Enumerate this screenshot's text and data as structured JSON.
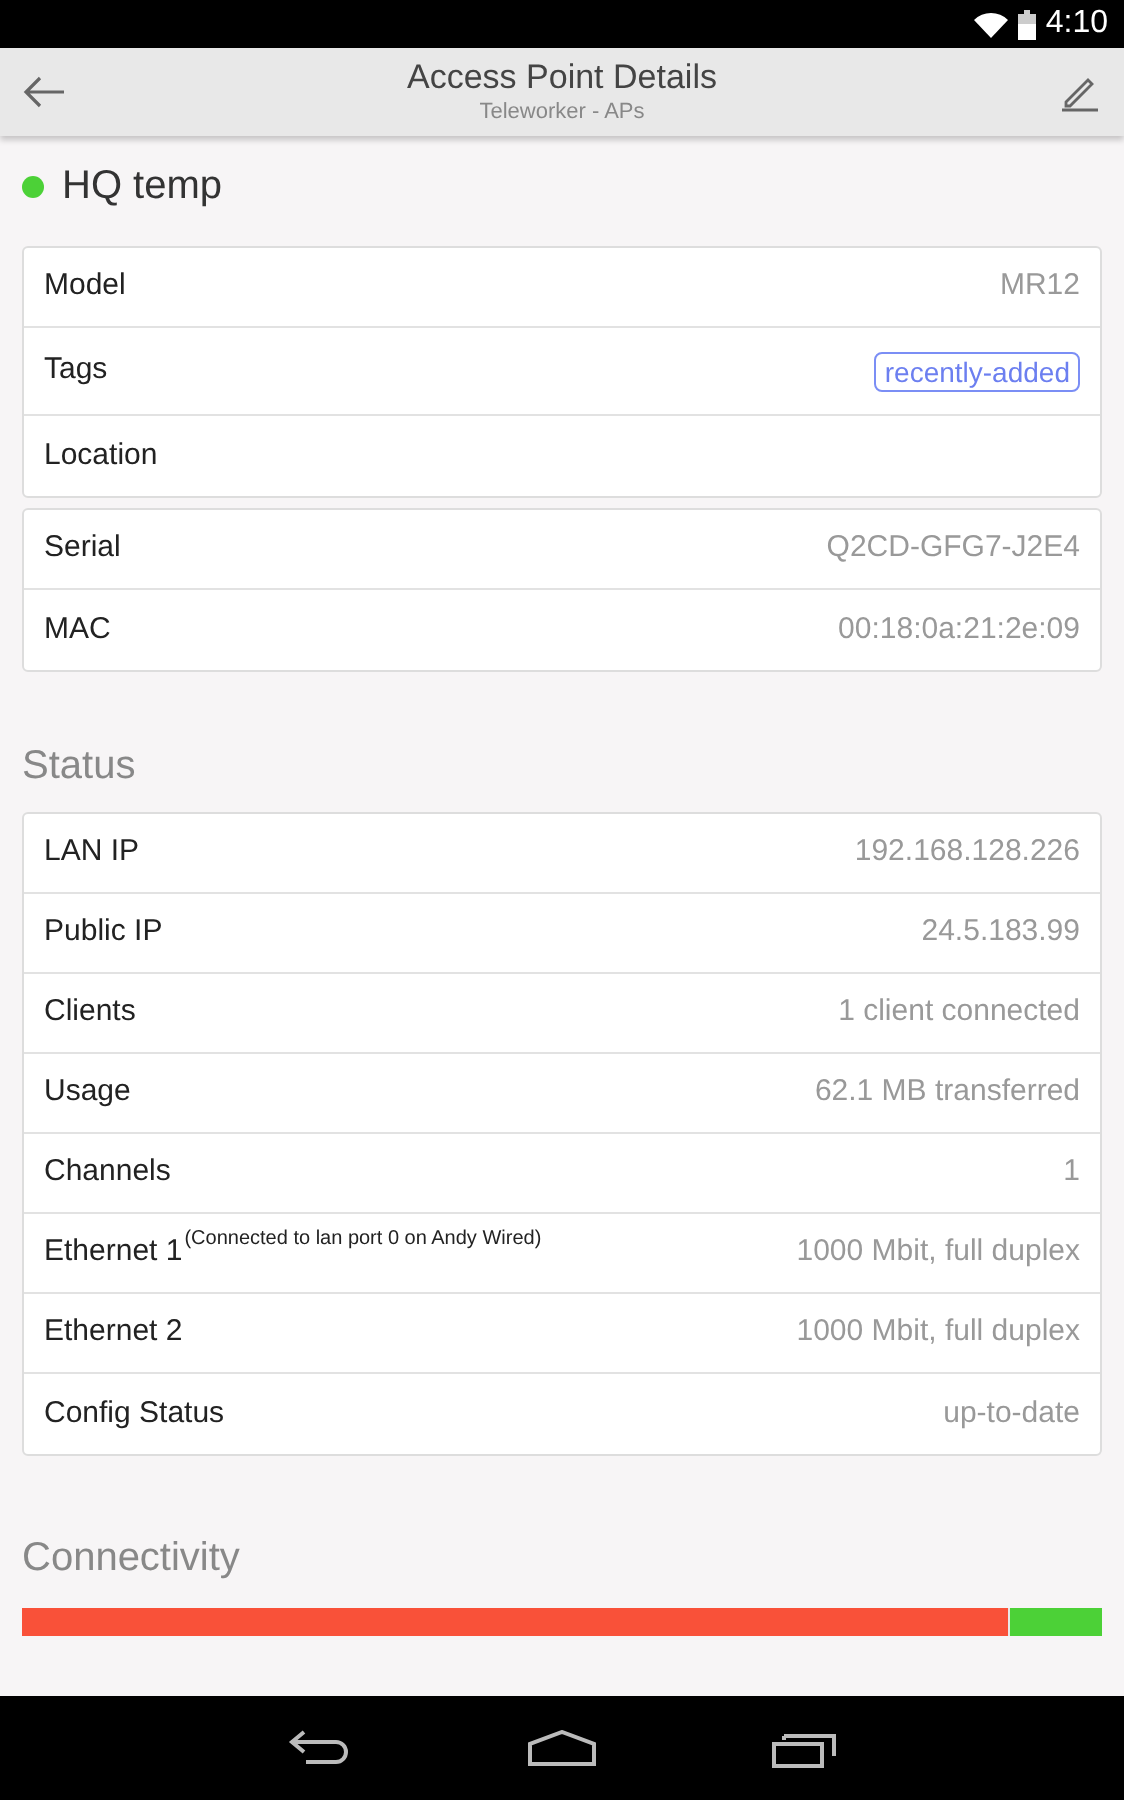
{
  "status_bar": {
    "time": "4:10"
  },
  "app_bar": {
    "title": "Access Point Details",
    "subtitle": "Teleworker - APs"
  },
  "device": {
    "name": "HQ temp",
    "online": true
  },
  "cards": [
    {
      "rows": [
        {
          "kind": "text",
          "label": "Model",
          "value": "MR12"
        },
        {
          "kind": "tag",
          "label": "Tags",
          "value": "recently-added"
        },
        {
          "kind": "text",
          "label": "Location"
        }
      ]
    },
    {
      "rows": [
        {
          "kind": "text",
          "label": "Serial",
          "value": "Q2CD-GFG7-J2E4"
        },
        {
          "kind": "text",
          "label": "MAC",
          "value": "00:18:0a:21:2e:09"
        }
      ]
    }
  ],
  "status": {
    "heading": "Status",
    "rows": [
      {
        "label": "LAN IP",
        "value": "192.168.128.226"
      },
      {
        "label": "Public IP",
        "value": "24.5.183.99"
      },
      {
        "label": "Clients",
        "value": "1 client connected"
      },
      {
        "label": "Usage",
        "value": "62.1 MB transferred"
      },
      {
        "label": "Channels",
        "value": "1"
      },
      {
        "label": "Ethernet 1",
        "note": "(Connected to lan port 0 on Andy Wired)",
        "value": "1000 Mbit, full duplex"
      },
      {
        "label": "Ethernet 2",
        "value": "1000 Mbit, full duplex"
      },
      {
        "label": "Config Status",
        "value": "up-to-date"
      }
    ]
  },
  "connectivity": {
    "heading": "Connectivity",
    "level": 0.915
  }
}
